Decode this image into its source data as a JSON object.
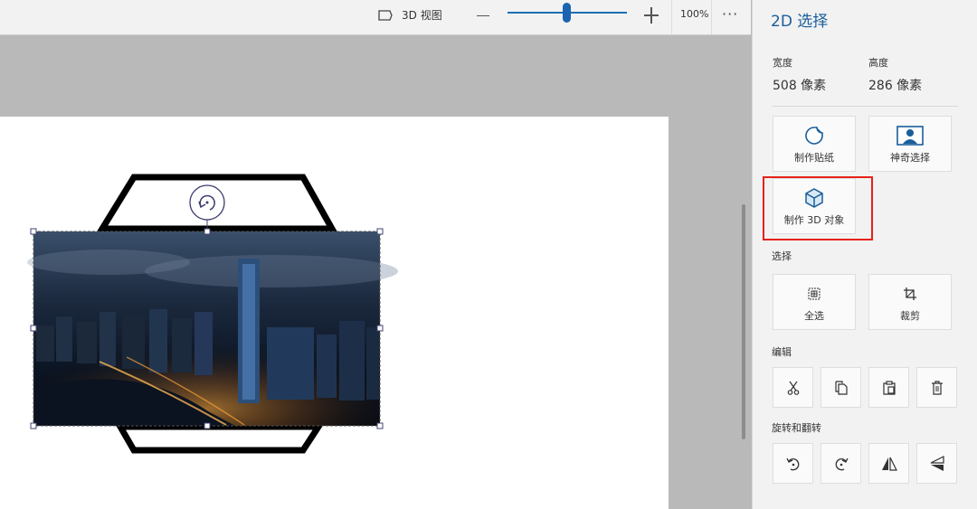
{
  "toolbar": {
    "view3d_label": "3D 视图",
    "zoom_percent": "100%",
    "zoom_level": 0.5,
    "more_label": "···"
  },
  "panel": {
    "title": "2D 选择",
    "width_label": "宽度",
    "width_value": "508 像素",
    "height_label": "高度",
    "height_value": "286 像素",
    "make_sticker_label": "制作贴纸",
    "magic_select_label": "神奇选择",
    "make_3d_label": "制作 3D 对象",
    "select_section": "选择",
    "select_all_label": "全选",
    "crop_label": "裁剪",
    "edit_section": "编辑",
    "rotate_section": "旋转和翻转"
  },
  "icons": {
    "view3d": "3d-view-icon",
    "cut": "scissors-icon",
    "copy": "copy-icon",
    "paste": "paste-icon",
    "delete": "trash-icon",
    "rotate_left": "rotate-left-icon",
    "rotate_right": "rotate-right-icon",
    "flip_vertical": "flip-vertical-icon",
    "flip_horizontal": "flip-horizontal-icon"
  },
  "colors": {
    "accent": "#1a5e9a",
    "highlight": "#e8201b",
    "canvas": "#ffffff",
    "workspace": "#b9b9b9"
  }
}
